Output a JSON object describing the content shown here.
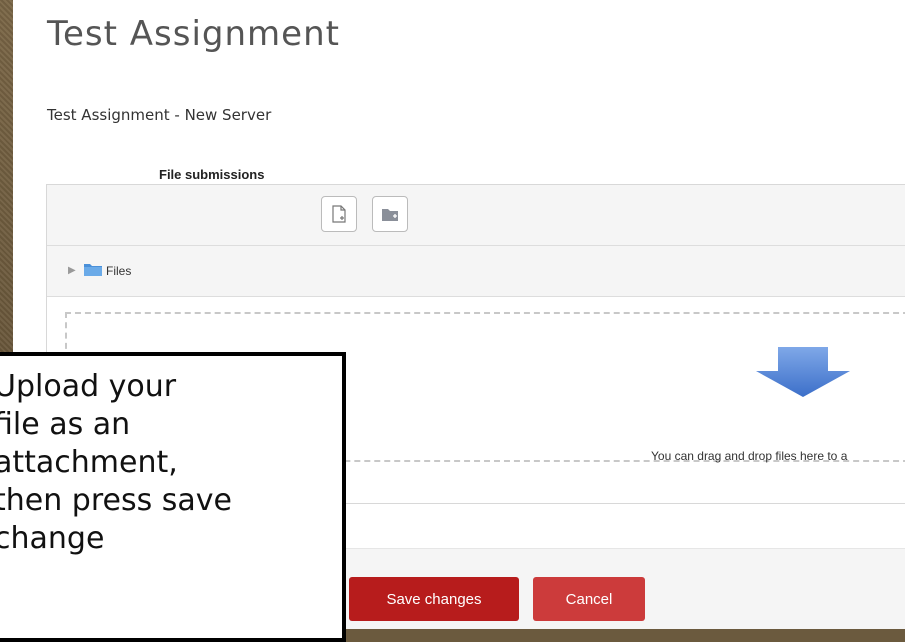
{
  "page": {
    "title": "Test Assignment",
    "subtitle": "Test Assignment - New Server"
  },
  "file_manager": {
    "section_label": "File submissions",
    "toolbar": {
      "add_file_icon": "add-file-icon",
      "create_folder_icon": "create-folder-icon"
    },
    "files_label": "Files",
    "drop_text": "You can drag and drop files here to a"
  },
  "actions": {
    "save_label": "Save changes",
    "cancel_label": "Cancel"
  },
  "callout": {
    "lines": [
      "Upload your",
      "file as an",
      "attachment,",
      "then press save",
      "change"
    ]
  },
  "colors": {
    "primary_button": "#b71c1c",
    "folder_blue": "#4a90d9"
  }
}
